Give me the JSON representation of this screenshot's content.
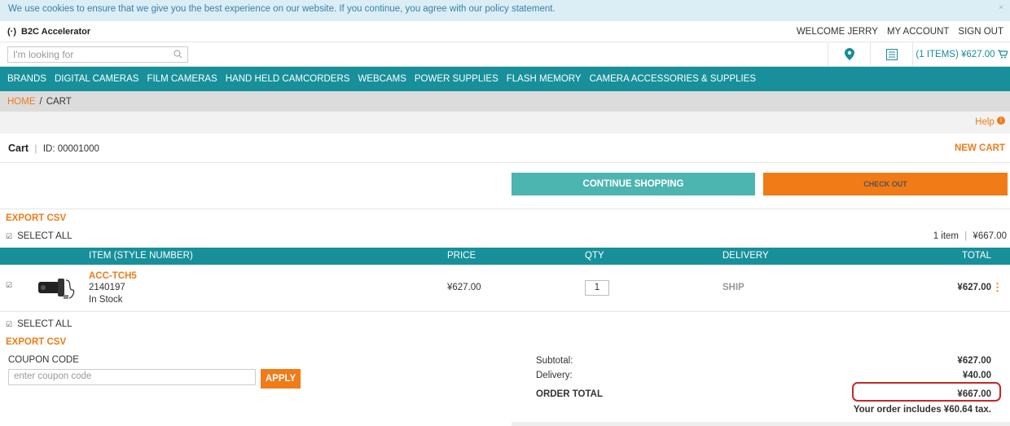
{
  "cookie": {
    "text": "We use cookies to ensure that we give you the best experience on our website. If you continue, you agree with our policy statement.",
    "close": "×"
  },
  "header": {
    "logo_mark": "(·)",
    "logo_text": "B2C Accelerator",
    "links": [
      "WELCOME JERRY",
      "MY ACCOUNT",
      "SIGN OUT"
    ]
  },
  "search": {
    "placeholder": "I'm looking for",
    "icon": "search-icon"
  },
  "utility": {
    "store_icon": "map-pin-icon",
    "list_icon": "list-icon",
    "cart_label": "(1 ITEMS) ¥627.00",
    "cart_icon": "cart-icon"
  },
  "nav": [
    "BRANDS",
    "DIGITAL CAMERAS",
    "FILM CAMERAS",
    "HAND HELD CAMCORDERS",
    "WEBCAMS",
    "POWER SUPPLIES",
    "FLASH MEMORY",
    "CAMERA ACCESSORIES & SUPPLIES"
  ],
  "breadcrumb": {
    "home": "HOME",
    "sep": "/",
    "current": "CART"
  },
  "help": "Help",
  "cart": {
    "title": "Cart",
    "id_label": "ID: 00001000",
    "new_cart": "NEW CART"
  },
  "buttons": {
    "continue": "CONTINUE SHOPPING",
    "checkout": "CHECK OUT"
  },
  "export_csv": "EXPORT CSV",
  "select_all": "SELECT ALL",
  "summary": {
    "items": "1 item",
    "total": "¥667.00"
  },
  "table": {
    "headers": {
      "item": "ITEM (STYLE NUMBER)",
      "price": "PRICE",
      "qty": "QTY",
      "delivery": "DELIVERY",
      "total": "TOTAL"
    },
    "rows": [
      {
        "code": "ACC-TCH5",
        "style": "2140197",
        "stock": "In Stock",
        "price": "¥627.00",
        "qty": "1",
        "delivery": "SHIP",
        "total": "¥627.00"
      }
    ]
  },
  "coupon": {
    "label": "COUPON CODE",
    "placeholder": "enter coupon code",
    "apply": "APPLY"
  },
  "totals": {
    "subtotal_label": "Subtotal:",
    "subtotal": "¥627.00",
    "delivery_label": "Delivery:",
    "delivery": "¥40.00",
    "order_total_label": "ORDER TOTAL",
    "order_total": "¥667.00",
    "tax_note": "Your order includes ¥60.64 tax."
  },
  "colors": {
    "teal": "#17909b",
    "orange": "#f07b17",
    "highlight": "#c62828"
  }
}
